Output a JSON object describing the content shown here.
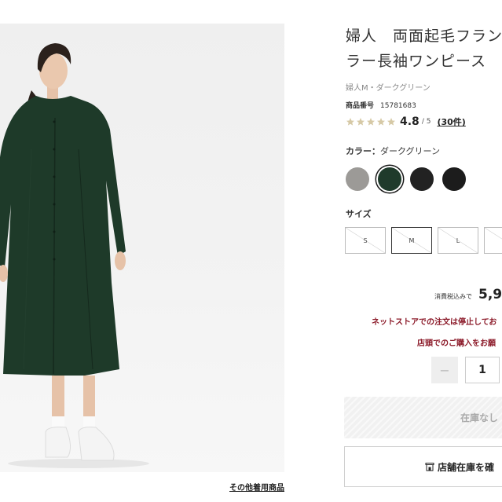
{
  "product": {
    "title_line1": "婦人　両面起毛フラン",
    "title_line2": "ラー長袖ワンピース",
    "variant": "婦人M・ダークグリーン",
    "number_label": "商品番号",
    "number": "15781683"
  },
  "rating": {
    "score": "4.8",
    "out_of": "/ 5",
    "count": "(30件)",
    "stars_filled": 5,
    "star_color": "#d6c9a6"
  },
  "color": {
    "label": "カラー：",
    "selected_name": "ダークグリーン",
    "swatches": [
      {
        "name": "gray",
        "hex": "#9c9a97"
      },
      {
        "name": "dark-green",
        "hex": "#1f3a2b",
        "selected": true
      },
      {
        "name": "black",
        "hex": "#222222"
      },
      {
        "name": "black-2",
        "hex": "#1c1c1c"
      }
    ]
  },
  "size": {
    "label": "サイズ",
    "options": [
      "S",
      "M",
      "L",
      ""
    ],
    "selected": "M"
  },
  "price": {
    "tax_label": "消費税込みで",
    "value": "5,9"
  },
  "notices": {
    "line1": "ネットストアでの注文は停止してお",
    "line2": "店頭でのご購入をお願"
  },
  "quantity": {
    "minus": "−",
    "value": "1"
  },
  "buttons": {
    "out_of_stock": "在庫なし",
    "store_stock": "店舗在庫を確"
  },
  "photo": {
    "more_link": "その他着用商品"
  },
  "colors": {
    "accent_red": "#8c1b2a",
    "dress_green": "#1e3a29"
  }
}
